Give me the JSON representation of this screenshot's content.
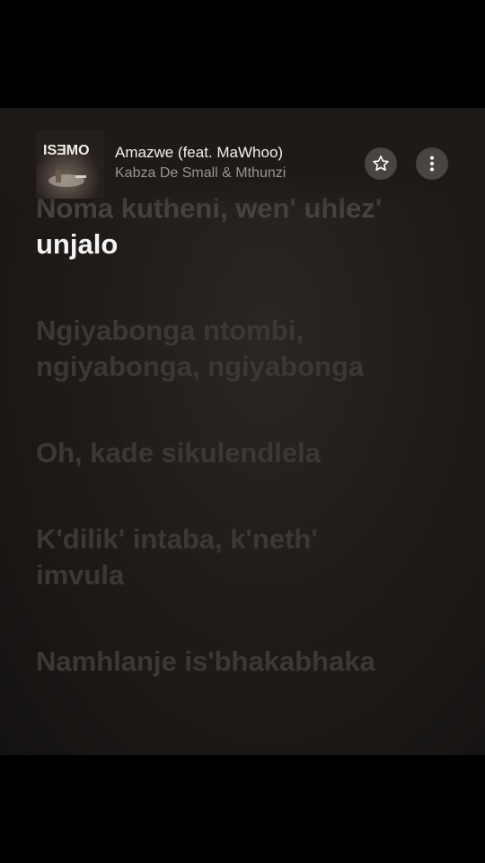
{
  "now_playing": {
    "title": "Amazwe (feat. MaWhoo)",
    "artist": "Kabza De Small & Mthunzi",
    "album_art_text": "ISƎMO"
  },
  "actions": {
    "favorite_icon": "star-icon",
    "more_icon": "more-vertical-icon"
  },
  "lyrics": {
    "partial_line": "Noma kutheni, wen' uhlez'",
    "active_line": "unjalo",
    "upcoming": [
      [
        "Ngiyabonga ntombi,",
        "ngiyabonga, ngiyabonga"
      ],
      [
        "Oh, kade sikulendlela"
      ],
      [
        "K'dilik' intaba, k'neth'",
        "imvula"
      ],
      [
        "Namhlanje is'bhakabhaka"
      ]
    ]
  },
  "colors": {
    "background": "#1d1a18",
    "active_lyric": "#f4f4f4",
    "inactive_lyric": "#3b3836",
    "button_bg": "#4a4542"
  }
}
